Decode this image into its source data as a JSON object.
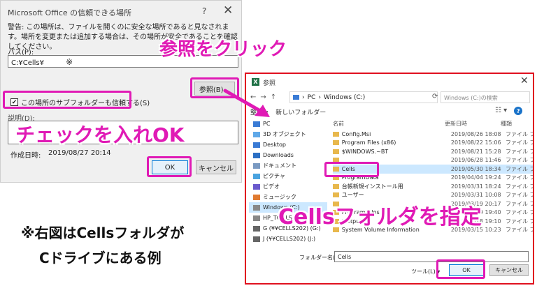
{
  "trusted_location_dialog": {
    "title": "Microsoft Office の信頼できる場所",
    "help_label": "?",
    "close_label": "✕",
    "warning": "警告: この場所は、ファイルを開くのに安全な場所であると見なされます。場所を変更または追加する場合は、その場所が安全であることを確認してください。",
    "path_label": "パス(P):",
    "path_value": "C:¥Cells¥",
    "path_marker": "※",
    "browse_button": "参照(B)...",
    "subfolder_checkbox_label": "この場所のサブフォルダーも信頼する(S)",
    "subfolder_checked": true,
    "description_label": "説明(D):",
    "date_label": "作成日時:",
    "date_value": "2019/08/27 20:14",
    "ok_button": "OK",
    "cancel_button": "キャンセル"
  },
  "browse_dialog": {
    "title": "参照",
    "close_label": "✕",
    "nav": {
      "back": "←",
      "forward": "→",
      "up": "↑"
    },
    "address": [
      "PC",
      "Windows (C:)"
    ],
    "search_placeholder": "Windows (C:)の検索",
    "toolbar": {
      "organize": "整理 ▾",
      "new_folder": "新しいフォルダー"
    },
    "sidebar": [
      {
        "label": "PC",
        "icon": "pc-icon"
      },
      {
        "label": "3D オブジェクト",
        "icon": "cube-icon"
      },
      {
        "label": "Desktop",
        "icon": "desktop-icon"
      },
      {
        "label": "Downloads",
        "icon": "download-icon"
      },
      {
        "label": "ドキュメント",
        "icon": "document-icon"
      },
      {
        "label": "ピクチャ",
        "icon": "picture-icon"
      },
      {
        "label": "ビデオ",
        "icon": "video-icon"
      },
      {
        "label": "ミュージック",
        "icon": "music-icon"
      },
      {
        "label": "Windows (C:)",
        "icon": "drive-icon",
        "selected": true
      },
      {
        "label": "HP_TOOLS",
        "icon": "drive-icon"
      },
      {
        "label": "G (¥¥CELLS202) (G:)",
        "icon": "network-drive-icon"
      },
      {
        "label": "J (¥¥CELLS202) (J:)",
        "icon": "network-drive-icon"
      }
    ],
    "columns": {
      "name": "名前",
      "modified": "更新日時",
      "type": "種類"
    },
    "files": [
      {
        "name": "Config.Msi",
        "date": "2019/08/26 18:08",
        "type": "ファイル フォ"
      },
      {
        "name": "Program Files (x86)",
        "date": "2019/08/22 15:06",
        "type": "ファイル フォ"
      },
      {
        "name": "$WINDOWS.~BT",
        "date": "2019/08/21 15:28",
        "type": "ファイル フォ"
      },
      {
        "name": "",
        "date": "2019/06/28 11:46",
        "type": "ファイル フォ"
      },
      {
        "name": "Cells",
        "date": "2019/05/30 18:34",
        "type": "ファイル フォ",
        "selected": true
      },
      {
        "name": "ProgramData",
        "date": "2019/04/04 19:24",
        "type": "ファイル フォ"
      },
      {
        "name": "台帳新規インストール用",
        "date": "2019/03/31 18:24",
        "type": "ファイル フォ"
      },
      {
        "name": "ユーザー",
        "date": "2019/03/31 10:08",
        "type": "ファイル フォ"
      },
      {
        "name": "",
        "date": "2019/03/19 20:17",
        "type": "ファイル フォ"
      },
      {
        "name": "Program Files",
        "date": "2019/03/19 19:40",
        "type": "ファイル フォ"
      },
      {
        "name": "inetpub",
        "date": "2019/03/18 19:10",
        "type": "ファイル フォ"
      },
      {
        "name": "System Volume Information",
        "date": "2019/03/15 10:23",
        "type": "ファイル フォ"
      }
    ],
    "folder_name_label": "フォルダー名(N):",
    "folder_name_value": "Cells",
    "tools_button": "ツール(L) ▾",
    "ok_button": "OK",
    "cancel_button": "キャンセル"
  },
  "annotations": {
    "click_browse": "参照をクリック",
    "check_and_ok": "チェックを入れOK",
    "specify_folder": "Cellsフォルダを指定",
    "footnote_line1": "※右図はCellsフォルダが",
    "footnote_line2": "Cドライブにある例"
  },
  "colors": {
    "accent_magenta": "#e01ab5",
    "frame_red": "#e0101f",
    "selection_blue": "#cce8ff"
  }
}
